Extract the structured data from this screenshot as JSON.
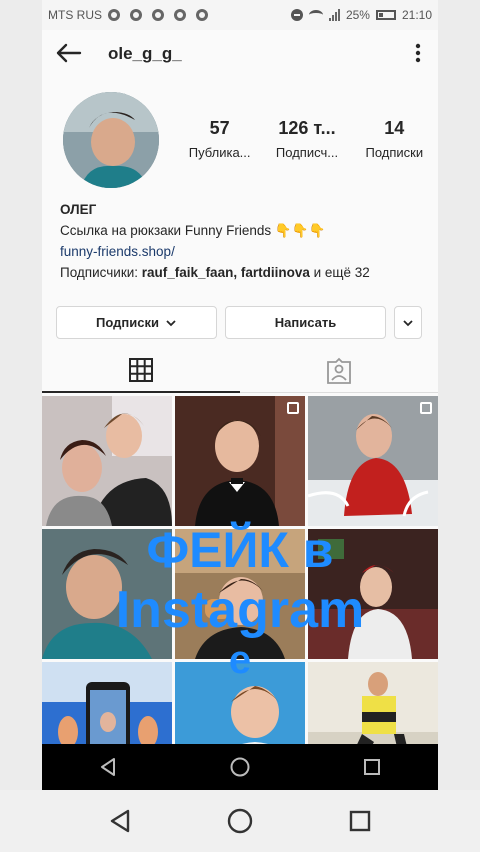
{
  "status_bar": {
    "carrier": "MTS RUS",
    "battery": "25%",
    "time": "21:10"
  },
  "profile": {
    "username": "ole_g_g_",
    "posts": {
      "count": "57",
      "label": "Публика..."
    },
    "followers": {
      "count": "126 т...",
      "label": "Подписч..."
    },
    "following": {
      "count": "14",
      "label": "Подписки"
    },
    "display_name": "ОЛЕГ",
    "bio_text": "Ссылка на рюкзаки Funny Friends",
    "bio_emoji": "👇👇👇",
    "link": "funny-friends.shop/",
    "followed_by_prefix": "Подписчики:",
    "followed_by_names": "rauf_faik_faan, fartdiinova",
    "followed_by_suffix": "и ещё 32"
  },
  "buttons": {
    "subscribed": "Подписки",
    "message": "Написать"
  },
  "overlay": {
    "line1": "ФЕЙК в",
    "line2": "Instagram",
    "line3": "е"
  },
  "colors": {
    "accent": "#1e8bff",
    "link": "#1b3a6b"
  },
  "icons": [
    "back-arrow-icon",
    "more-vert-icon",
    "grid-icon",
    "tagged-icon",
    "chevron-down-icon"
  ]
}
